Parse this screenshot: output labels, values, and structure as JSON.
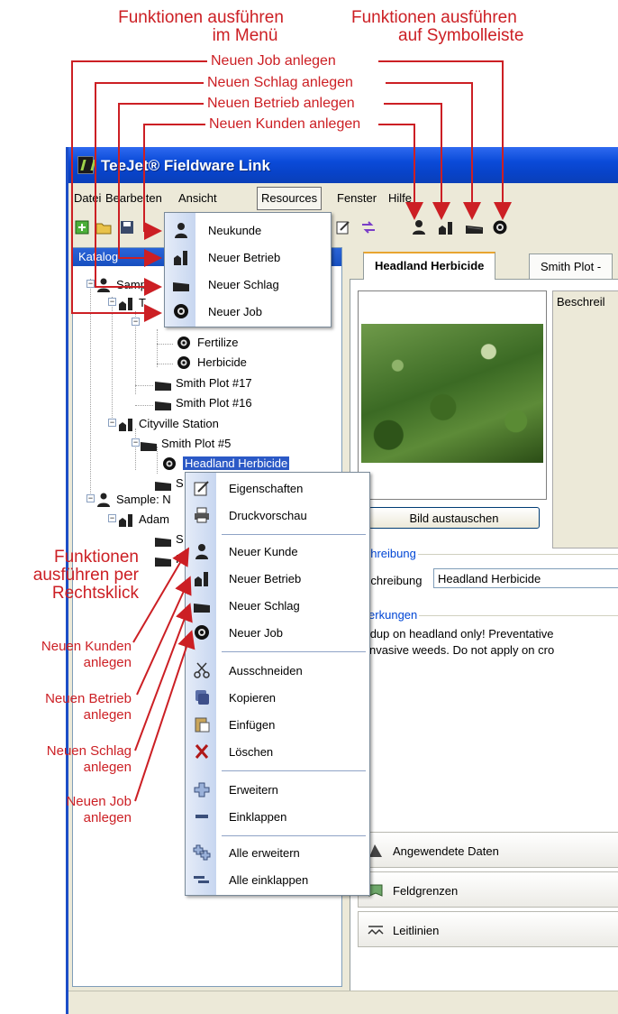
{
  "annotations": {
    "menu_heading_line1": "Funktionen ausführen",
    "menu_heading_line2": "im Menü",
    "toolbar_heading_line1": "Funktionen ausführen",
    "toolbar_heading_line2": "auf Symbolleiste",
    "new_job": "Neuen Job anlegen",
    "new_field": "Neuen Schlag anlegen",
    "new_farm": "Neuen Betrieb anlegen",
    "new_customer": "Neuen Kunden anlegen",
    "rightclick_line1": "Funktionen",
    "rightclick_line2": "ausführen per",
    "rightclick_line3": "Rechtsklick",
    "left_customer_1": "Neuen Kunden",
    "left_customer_2": "anlegen",
    "left_farm_1": "Neuen Betrieb",
    "left_farm_2": "anlegen",
    "left_field_1": "Neuen Schlag",
    "left_field_2": "anlegen",
    "left_job_1": "Neuen Job",
    "left_job_2": "anlegen",
    "color": "#cc1f24"
  },
  "window": {
    "title": "TeeJet® Fieldware Link",
    "menu": [
      "Datei",
      "Bearbeiten",
      "Ansicht",
      "Resources",
      "Fenster",
      "Hilfe"
    ]
  },
  "catalog": {
    "header": "Katalog",
    "items": {
      "sample1": "Samp",
      "t": "T",
      "fertilize": "Fertilize",
      "herbicide": "Herbicide",
      "plot17": "Smith Plot #17",
      "plot16": "Smith Plot #16",
      "cityville": "Cityville Station",
      "plot5": "Smith Plot #5",
      "headland": "Headland Herbicide",
      "s_short": "S",
      "sample2": "Sample: N",
      "adam": "Adam",
      "s2": "S",
      "p": "P"
    }
  },
  "resources_menu": [
    "Neukunde",
    "Neuer Betrieb",
    "Neuer Schlag",
    "Neuer Job"
  ],
  "context_menu": [
    "Eigenschaften",
    "Druckvorschau",
    "Neuer Kunde",
    "Neuer Betrieb",
    "Neuer Schlag",
    "Neuer Job",
    "Ausschneiden",
    "Kopieren",
    "Einfügen",
    "Löschen",
    "Erweitern",
    "Einklappen",
    "Alle erweitern",
    "Alle einklappen"
  ],
  "detail": {
    "tabs": [
      "Headland Herbicide",
      "Smith Plot -"
    ],
    "description_box": "Beschreil",
    "replace_image": "Bild austauschen",
    "group_description": "eschreibung",
    "description_label": "Beschreibung",
    "description_value": "Headland Herbicide",
    "group_notes": "emerkungen",
    "notes_line1": "oundup on headland only!  Preventative",
    "notes_line2": "op invasive weeds.  Do not apply on cro",
    "bottom_buttons": [
      "Angewendete Daten",
      "Feldgrenzen",
      "Leitlinien"
    ]
  }
}
